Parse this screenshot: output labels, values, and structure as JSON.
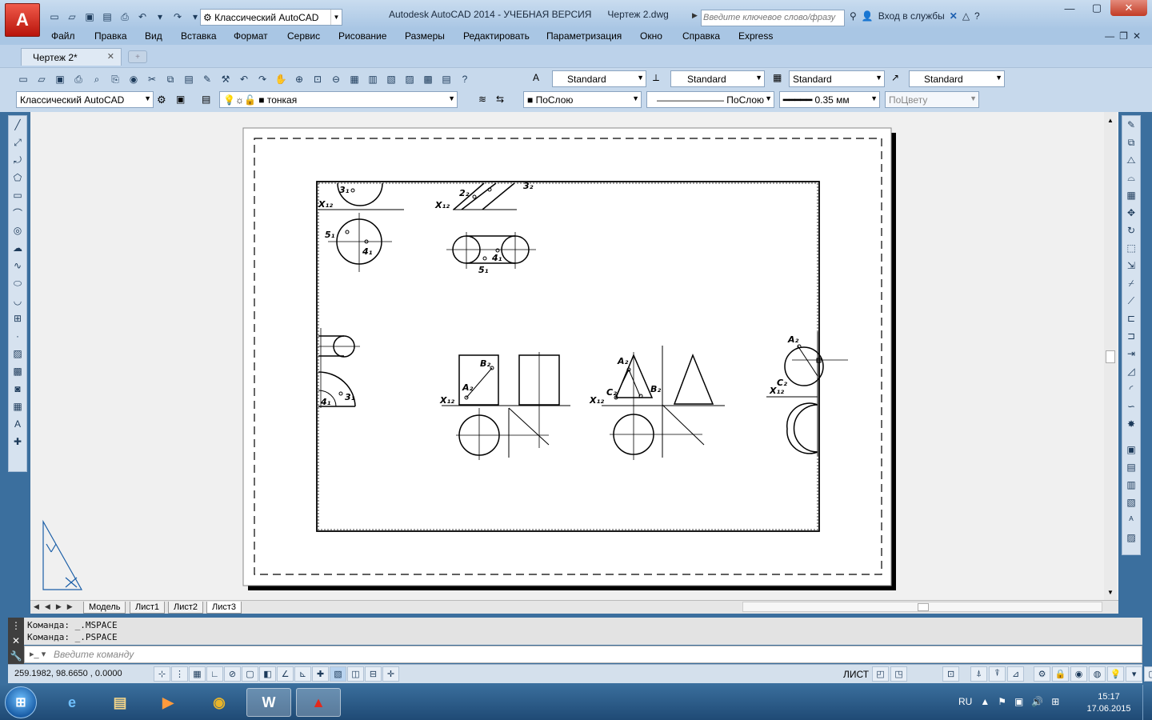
{
  "app": {
    "title": "Autodesk AutoCAD 2014 - УЧЕБНАЯ ВЕРСИЯ      Чертеж 2.dwg",
    "logo_letter": "A",
    "workspace": "Классический AutoCAD",
    "search_placeholder": "Введите ключевое слово/фразу",
    "login_label": "Вход в службы",
    "accent_color": "#c8201a"
  },
  "menu": [
    "Файл",
    "Правка",
    "Вид",
    "Вставка",
    "Формат",
    "Сервис",
    "Рисование",
    "Размеры",
    "Редактировать",
    "Параметризация",
    "Окно",
    "Справка",
    "Express"
  ],
  "tabs": {
    "active_doc": "Чертеж 2*"
  },
  "styles_toolbar": {
    "text_style": "Standard",
    "dim_style": "Standard",
    "table_style": "Standard",
    "mleader_style": "Standard"
  },
  "layers_toolbar": {
    "workspace": "Классический AutoCAD",
    "layer": "тонкая",
    "color": "ПоСлою",
    "linetype": "ПоСлою",
    "lineweight": "0.35 мм",
    "plotstyle": "ПоЦвету"
  },
  "drawing": {
    "labels": {
      "l_3_1": "3₁",
      "l_x12_top": "X₁₂",
      "l_2_2": "2₂",
      "l_x12_top2": "X₁₂",
      "l_3_2": "3₂",
      "l_5_1": "5₁",
      "l_4_1": "4₁",
      "l_4_1b": "4₁",
      "l_5_1b": "5₁",
      "l_3_1b": "3₁",
      "l_4_1c": "4₁",
      "l_b2": "B₂",
      "l_a2": "A₂",
      "l_x12_mid": "X₁₂",
      "l_a2b": "A₂",
      "l_c2": "C₂",
      "l_b2b": "B₂",
      "l_x12_mid2": "X₁₂",
      "l_a2c": "A₂",
      "l_c2b": "C₂",
      "l_x12_right": "X₁₂"
    }
  },
  "layout_tabs": [
    "Модель",
    "Лист1",
    "Лист2",
    "Лист3"
  ],
  "active_layout": "Лист3",
  "command": {
    "history": [
      "Команда:  _.MSPACE",
      "Команда:  _.PSPACE"
    ],
    "placeholder": "Введите команду"
  },
  "status": {
    "coords": "259.1982, 98.6650 , 0.0000",
    "space_label": "ЛИСТ"
  },
  "taskbar": {
    "lang": "RU",
    "time": "15:17",
    "date": "17.06.2015"
  }
}
